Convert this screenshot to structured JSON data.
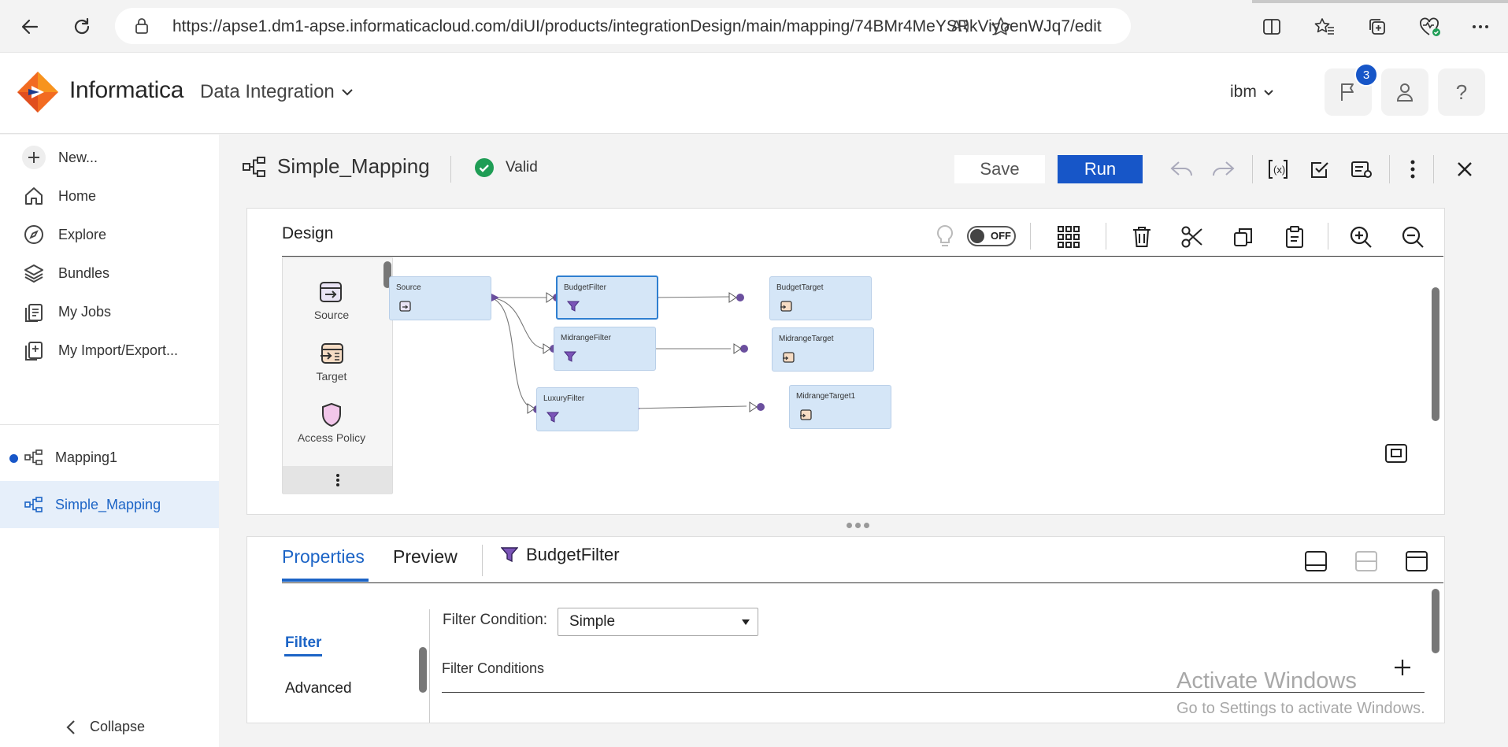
{
  "browser": {
    "url": "https://apse1.dm1-apse.informaticacloud.com/diUI/products/integrationDesign/main/mapping/74BMr4MeYSRkViyoenWJq7/edit"
  },
  "header": {
    "brand": "Informatica",
    "product": "Data Integration",
    "org": "ibm",
    "notification_count": "3"
  },
  "sidebar": {
    "new_label": "New...",
    "items": [
      {
        "label": "Home",
        "icon": "home-icon"
      },
      {
        "label": "Explore",
        "icon": "compass-icon"
      },
      {
        "label": "Bundles",
        "icon": "layers-icon"
      },
      {
        "label": "My Jobs",
        "icon": "jobs-icon"
      },
      {
        "label": "My Import/Export..."
      }
    ],
    "open_items": [
      {
        "label": "Mapping1",
        "unsaved": true
      },
      {
        "label": "Simple_Mapping",
        "active": true
      }
    ],
    "collapse_label": "Collapse"
  },
  "mapping": {
    "title": "Simple_Mapping",
    "status": "Valid",
    "save_label": "Save",
    "run_label": "Run"
  },
  "design": {
    "title": "Design",
    "toggle_label": "OFF",
    "palette": [
      {
        "label": "Source"
      },
      {
        "label": "Target"
      },
      {
        "label": "Access Policy"
      }
    ],
    "nodes": [
      {
        "label": "Source"
      },
      {
        "label": "BudgetFilter"
      },
      {
        "label": "BudgetTarget"
      },
      {
        "label": "MidrangeFilter"
      },
      {
        "label": "MidrangeTarget"
      },
      {
        "label": "LuxuryFilter"
      },
      {
        "label": "MidrangeTarget1"
      }
    ]
  },
  "properties": {
    "tabs": [
      "Properties",
      "Preview"
    ],
    "selected_object": "BudgetFilter",
    "side_links": [
      "Filter",
      "Advanced"
    ],
    "filter_condition_label": "Filter Condition:",
    "filter_condition_value": "Simple",
    "filter_conditions_label": "Filter Conditions"
  },
  "watermark": {
    "line1": "Activate Windows",
    "line2": "Go to Settings to activate Windows."
  },
  "colors": {
    "accent": "#1756c8",
    "node_fill": "#d5e6f7",
    "port": "#6b4f9e",
    "valid": "#1f9d55"
  }
}
